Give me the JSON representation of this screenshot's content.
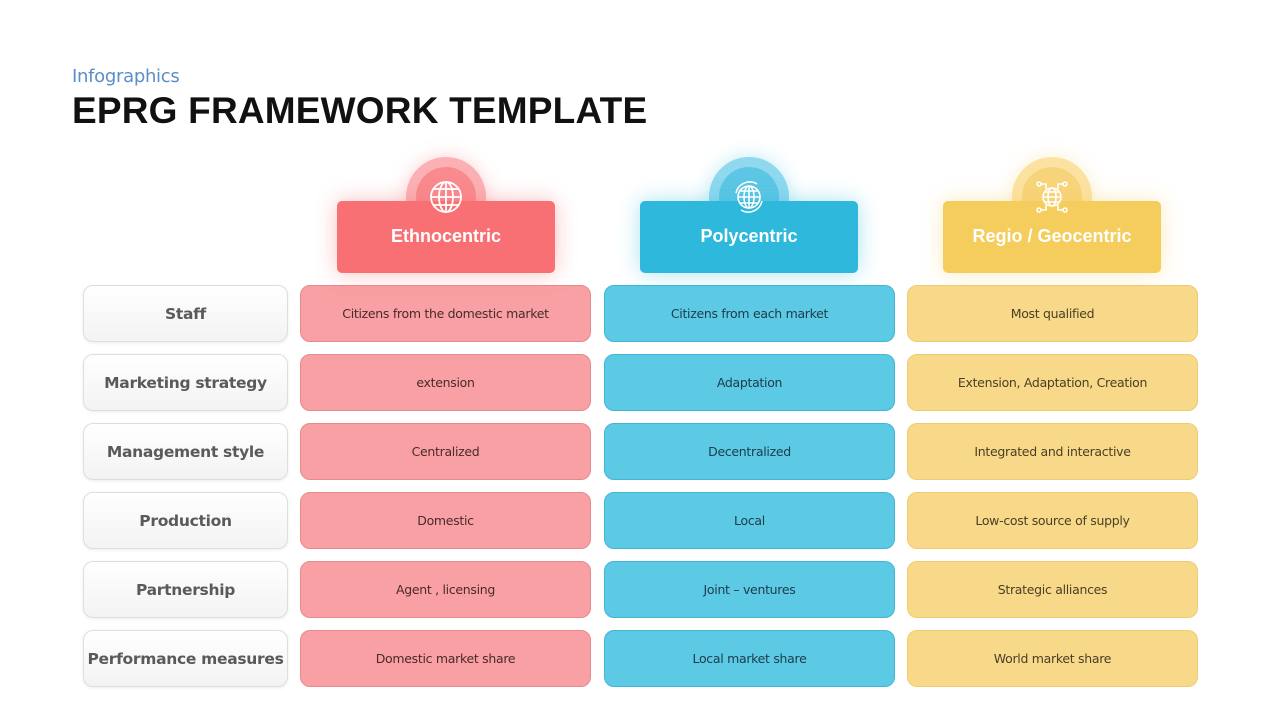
{
  "header": {
    "subtitle": "Infographics",
    "title": "EPRG FRAMEWORK TEMPLATE"
  },
  "columns": [
    {
      "label": "Ethnocentric",
      "icon": "globe-icon",
      "color": "#f87073"
    },
    {
      "label": "Polycentric",
      "icon": "globe-cycle-icon",
      "color": "#2db8dc"
    },
    {
      "label": "Regio / Geocentric",
      "icon": "globe-network-icon",
      "color": "#f5cd5c"
    }
  ],
  "rows": [
    {
      "label": "Staff",
      "cells": [
        "Citizens from the domestic market",
        "Citizens from each market",
        "Most qualified"
      ]
    },
    {
      "label": "Marketing strategy",
      "cells": [
        "extension",
        "Adaptation",
        "Extension, Adaptation, Creation"
      ]
    },
    {
      "label": "Management style",
      "cells": [
        "Centralized",
        "Decentralized",
        "Integrated and interactive"
      ]
    },
    {
      "label": "Production",
      "cells": [
        "Domestic",
        "Local",
        "Low-cost source of supply"
      ]
    },
    {
      "label": "Partnership",
      "cells": [
        "Agent , licensing",
        "Joint – ventures",
        "Strategic alliances"
      ]
    },
    {
      "label": "Performance measures",
      "cells": [
        "Domestic market share",
        "Local market share",
        "World market share"
      ]
    }
  ]
}
